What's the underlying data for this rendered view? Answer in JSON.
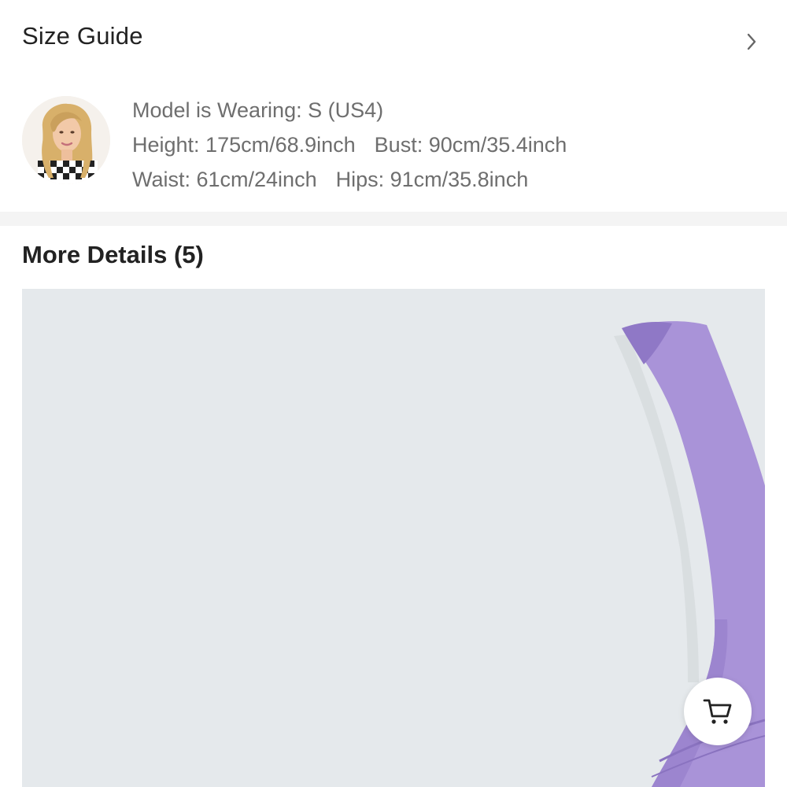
{
  "size_guide": {
    "title": "Size Guide"
  },
  "model": {
    "wearing": "Model is Wearing: S (US4)",
    "height": "Height: 175cm/68.9inch",
    "bust": "Bust: 90cm/35.4inch",
    "waist": "Waist: 61cm/24inch",
    "hips": "Hips: 91cm/35.8inch"
  },
  "details": {
    "title": "More Details (5)"
  },
  "icons": {
    "chevron": "chevron-right-icon",
    "cart": "shopping-cart-icon"
  },
  "colors": {
    "product": "#a993d8",
    "image_background": "#e5e9ec",
    "divider": "#f4f4f4"
  }
}
